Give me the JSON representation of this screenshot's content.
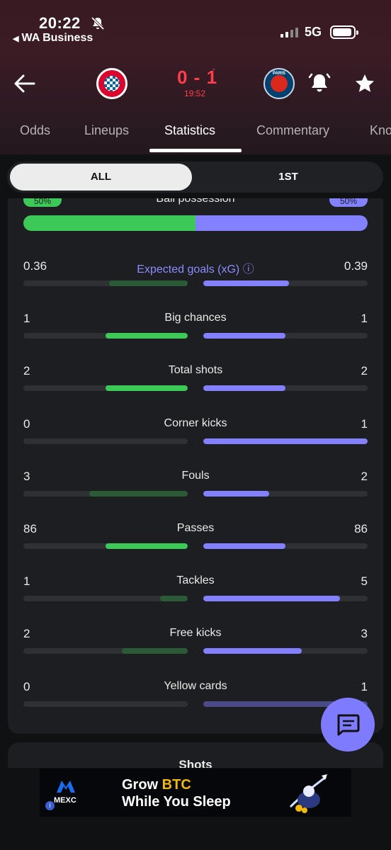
{
  "status_bar": {
    "time": "20:22",
    "back_app": "WA Business",
    "network": "5G"
  },
  "match": {
    "score": "0 - 1",
    "score_marker": "`",
    "clock": "19:52",
    "away_logo_text": "PARIS"
  },
  "tabs": [
    {
      "label": "Odds"
    },
    {
      "label": "Lineups"
    },
    {
      "label": "Statistics"
    },
    {
      "label": "Commentary"
    },
    {
      "label": "Kno"
    }
  ],
  "period_toggle": {
    "all": "ALL",
    "first": "1ST"
  },
  "possession": {
    "label": "Ball possession",
    "home": "50%",
    "away": "50%",
    "home_fraction": 0.5
  },
  "stats": [
    {
      "label": "Expected goals (xG)",
      "home": "0.36",
      "away": "0.39",
      "home_fill": 0.48,
      "away_fill": 0.52,
      "home_leads": false,
      "info": "ⓘ"
    },
    {
      "label": "Big chances",
      "home": "1",
      "away": "1",
      "home_fill": 0.5,
      "away_fill": 0.5,
      "home_leads": true
    },
    {
      "label": "Total shots",
      "home": "2",
      "away": "2",
      "home_fill": 0.5,
      "away_fill": 0.5,
      "home_leads": true
    },
    {
      "label": "Corner kicks",
      "home": "0",
      "away": "1",
      "home_fill": 0,
      "away_fill": 1,
      "home_leads": false
    },
    {
      "label": "Fouls",
      "home": "3",
      "away": "2",
      "home_fill": 0.6,
      "away_fill": 0.4,
      "home_leads": false
    },
    {
      "label": "Passes",
      "home": "86",
      "away": "86",
      "home_fill": 0.5,
      "away_fill": 0.5,
      "home_leads": true
    },
    {
      "label": "Tackles",
      "home": "1",
      "away": "5",
      "home_fill": 0.17,
      "away_fill": 0.83,
      "home_leads": false
    },
    {
      "label": "Free kicks",
      "home": "2",
      "away": "3",
      "home_fill": 0.4,
      "away_fill": 0.6,
      "home_leads": false
    },
    {
      "label": "Yellow cards",
      "home": "0",
      "away": "1",
      "home_fill": 0,
      "away_fill": 1,
      "home_leads": false,
      "away_dim": true
    }
  ],
  "shots_section": {
    "title": "Shots"
  },
  "ad": {
    "brand": "MEXC",
    "line1_a": "Grow ",
    "line1_b": "BTC",
    "line2": "While You Sleep",
    "info": "i"
  },
  "colors": {
    "home": "#3cc957",
    "away": "#8381ff",
    "score": "#ff3d4c"
  }
}
